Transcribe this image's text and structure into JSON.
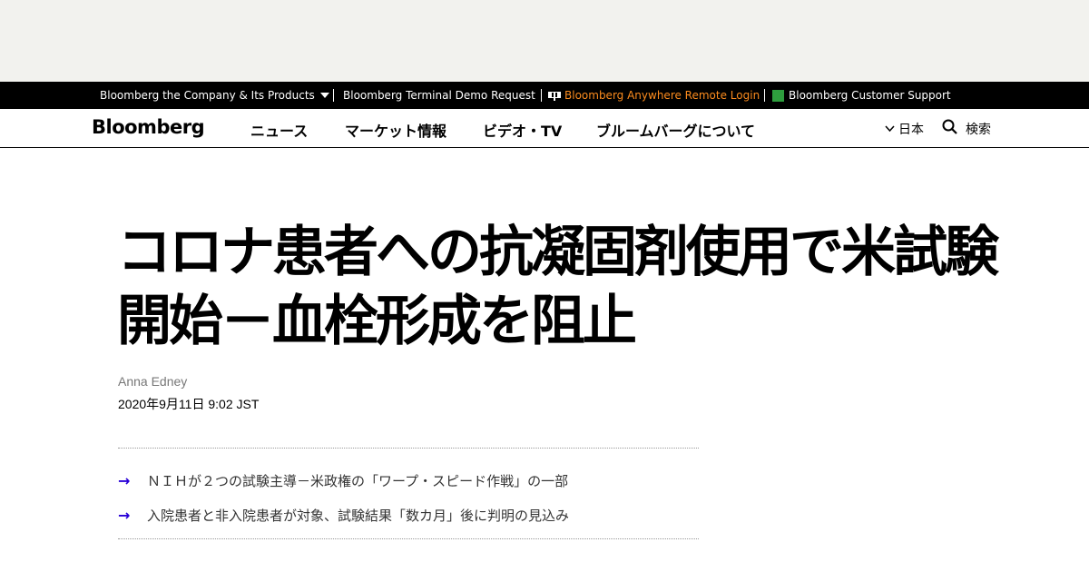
{
  "topbar": {
    "company_label": "Bloomberg the Company & Its Products",
    "terminal_label": "Bloomberg Terminal Demo Request",
    "anywhere_label": "Bloomberg Anywhere Remote Login",
    "support_label": "Bloomberg Customer Support",
    "anywhere_color": "#fb8b1e"
  },
  "nav": {
    "logo": "Bloomberg",
    "items": [
      {
        "label": "ニュース"
      },
      {
        "label": "マーケット情報"
      },
      {
        "label": "ビデオ・TV"
      },
      {
        "label": "ブルームバーグについて"
      }
    ],
    "language": "日本",
    "search_label": "検索"
  },
  "article": {
    "headline": "コロナ患者への抗凝固剤使用で米試験開始－血栓形成を阻止",
    "author": "Anna Edney",
    "date": "2020年9月11日 9:02 JST",
    "bullets": [
      {
        "text": "ＮＩＨが２つの試験主導－米政権の「ワープ・スピード作戦」の一部"
      },
      {
        "text": "入院患者と非入院患者が対象、試験結果「数カ月」後に判明の見込み"
      }
    ]
  },
  "colors": {
    "accent_arrow": "#2800d7",
    "topbar_bg": "#000000",
    "ad_bg": "#f2f2ee"
  }
}
